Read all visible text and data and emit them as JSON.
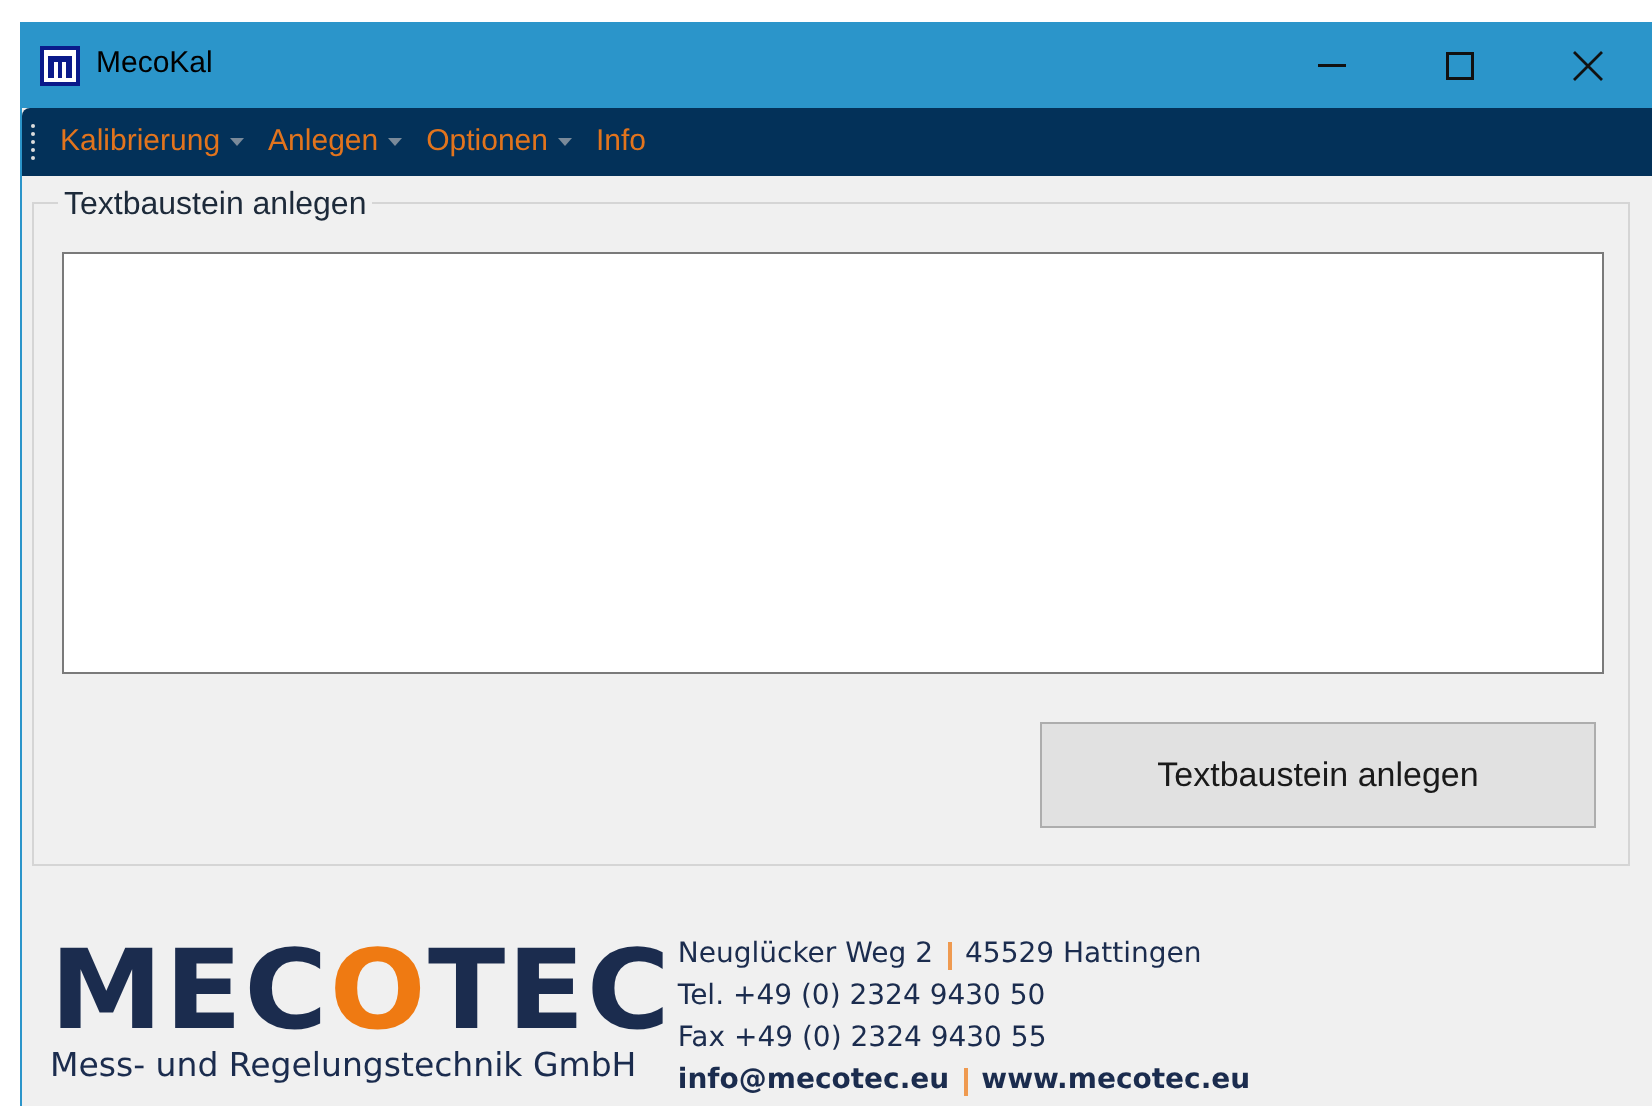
{
  "window": {
    "title": "MecoKal"
  },
  "menu": [
    {
      "label": "Kalibrierung",
      "has_dropdown": true
    },
    {
      "label": "Anlegen",
      "has_dropdown": true
    },
    {
      "label": "Optionen",
      "has_dropdown": true
    },
    {
      "label": "Info",
      "has_dropdown": false
    }
  ],
  "group": {
    "title": "Textbaustein anlegen",
    "button": "Textbaustein anlegen"
  },
  "footer": {
    "logo": {
      "before": "MEC",
      "highlight": "O",
      "after": "TEC"
    },
    "tagline": "Mess- und Regelungstechnik GmbH",
    "address_lines": [
      {
        "parts": [
          "Neuglücker Weg 2",
          "45529 Hattingen"
        ],
        "bold": false
      },
      {
        "parts": [
          "Tel. +49 (0) 2324 9430 50"
        ],
        "bold": false
      },
      {
        "parts": [
          "Fax +49 (0) 2324 9430 55"
        ],
        "bold": false
      },
      {
        "parts": [
          "info@mecotec.eu",
          "www.mecotec.eu"
        ],
        "bold": true
      }
    ]
  }
}
